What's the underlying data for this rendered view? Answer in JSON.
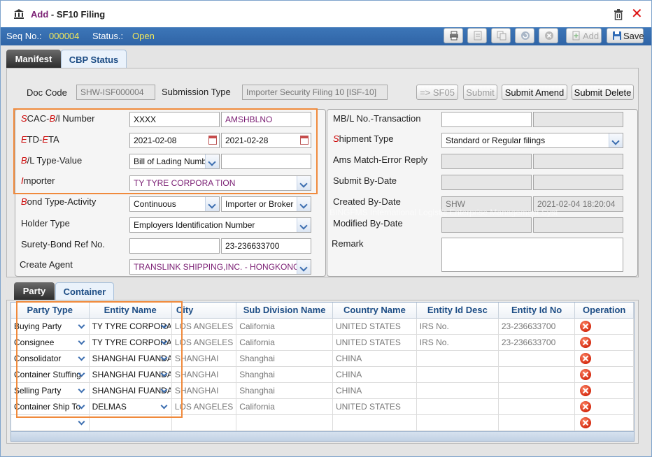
{
  "window": {
    "title_prefix": "Add",
    "title_sep": " - ",
    "title": "SF10 Filing"
  },
  "status": {
    "seq_label": "Seq No.:",
    "seq_value": "000004",
    "status_label": "Status.:",
    "status_value": "Open"
  },
  "toolbar": {
    "add_label": "Add",
    "save_label": "Save"
  },
  "tabs": [
    "Manifest",
    "CBP Status"
  ],
  "doc": {
    "doc_code_label": "Doc Code",
    "doc_code_value": "SHW-ISF000004",
    "submission_type_label": "Submission Type",
    "submission_type_value": "Importer Security Filing 10 [ISF-10]"
  },
  "actions": {
    "sf05": "=> SF05",
    "submit": "Submit",
    "submit_amend": "Submit Amend",
    "submit_delete": "Submit Delete"
  },
  "left": {
    "scac_label_parts": [
      "S",
      "CAC-",
      "B",
      "/l Number"
    ],
    "scac_value": "XXXX",
    "bl_value": "AMSHBLNO",
    "etd_label_parts": [
      "E",
      "TD-",
      "E",
      "TA"
    ],
    "etd_value": "2021-02-08",
    "eta_value": "2021-02-28",
    "bl_type_label_parts": [
      "B",
      "/L Type-Value"
    ],
    "bl_type_value": "Bill of Lading Number",
    "bl_type_value2": "",
    "importer_label_parts": [
      "I",
      "mporter"
    ],
    "importer_value": "TY TYRE CORPORA TION",
    "bond_label_parts": [
      "B",
      "ond Type-Activity"
    ],
    "bond_type_value": "Continuous",
    "bond_activity_value": "Importer or Broker",
    "holder_label": "Holder Type",
    "holder_value": "Employers Identification Number",
    "surety_label": "Surety-Bond Ref No.",
    "surety_value": "",
    "surety_value2": "23-236633700",
    "agent_label": "Create Agent",
    "agent_value": "TRANSLINK SHIPPING,INC. - HONGKONG"
  },
  "right": {
    "mbl_label": "MB/L No.-Transaction",
    "mbl_value": "",
    "mbl_value2": "",
    "shipment_label_parts": [
      "S",
      "hipment Type"
    ],
    "shipment_value": "Standard or Regular filings",
    "ams_label": "Ams Match-Error Reply",
    "submit_by_label": "Submit By-Date",
    "created_by_label": "Created By-Date",
    "created_by_value": "SHW",
    "created_date_value": "2021-02-04 18:20:04",
    "modified_by_label": "Modified By-Date",
    "remark_label": "Remark",
    "remark_value": ""
  },
  "watermark": "BINGFMS International Logistic Enterprise Management Syst",
  "party_tabs": [
    "Party",
    "Container"
  ],
  "party_table": {
    "columns": [
      "Party Type",
      "Entity Name",
      "City",
      "Sub Division Name",
      "Country Name",
      "Entity Id Desc",
      "Entity Id No",
      "Operation"
    ],
    "rows": [
      {
        "party_type": "Buying Party",
        "entity_name": "TY TYRE CORPORATION",
        "city": "LOS ANGELES",
        "sub_division": "California",
        "country": "UNITED STATES",
        "id_desc": "IRS No.",
        "id_no": "23-236633700"
      },
      {
        "party_type": "Consignee",
        "entity_name": "TY TYRE CORPORATION",
        "city": "LOS ANGELES",
        "sub_division": "California",
        "country": "UNITED STATES",
        "id_desc": "IRS No.",
        "id_no": "23-236633700"
      },
      {
        "party_type": "Consolidator",
        "entity_name": "SHANGHAI FUANDA",
        "city": "SHANGHAI",
        "sub_division": "Shanghai",
        "country": "CHINA",
        "id_desc": "",
        "id_no": ""
      },
      {
        "party_type": "Container Stuffing",
        "entity_name": "SHANGHAI FUANDA",
        "city": "SHANGHAI",
        "sub_division": "Shanghai",
        "country": "CHINA",
        "id_desc": "",
        "id_no": ""
      },
      {
        "party_type": "Selling Party",
        "entity_name": "SHANGHAI FUANDA",
        "city": "SHANGHAI",
        "sub_division": "Shanghai",
        "country": "CHINA",
        "id_desc": "",
        "id_no": ""
      },
      {
        "party_type": "Container Ship To",
        "entity_name": "DELMAS",
        "city": "LOS ANGELES",
        "sub_division": "California",
        "country": "UNITED STATES",
        "id_desc": "",
        "id_no": ""
      },
      {
        "party_type": "",
        "entity_name": "",
        "city": "",
        "sub_division": "",
        "country": "",
        "id_desc": "",
        "id_no": ""
      }
    ]
  },
  "colors": {
    "accent_blue": "#2f64a6",
    "status_yellow": "#f2e85a",
    "highlight_orange": "#f08a3c",
    "header_blue": "#1d4d85",
    "delete_red": "#d42a10"
  }
}
